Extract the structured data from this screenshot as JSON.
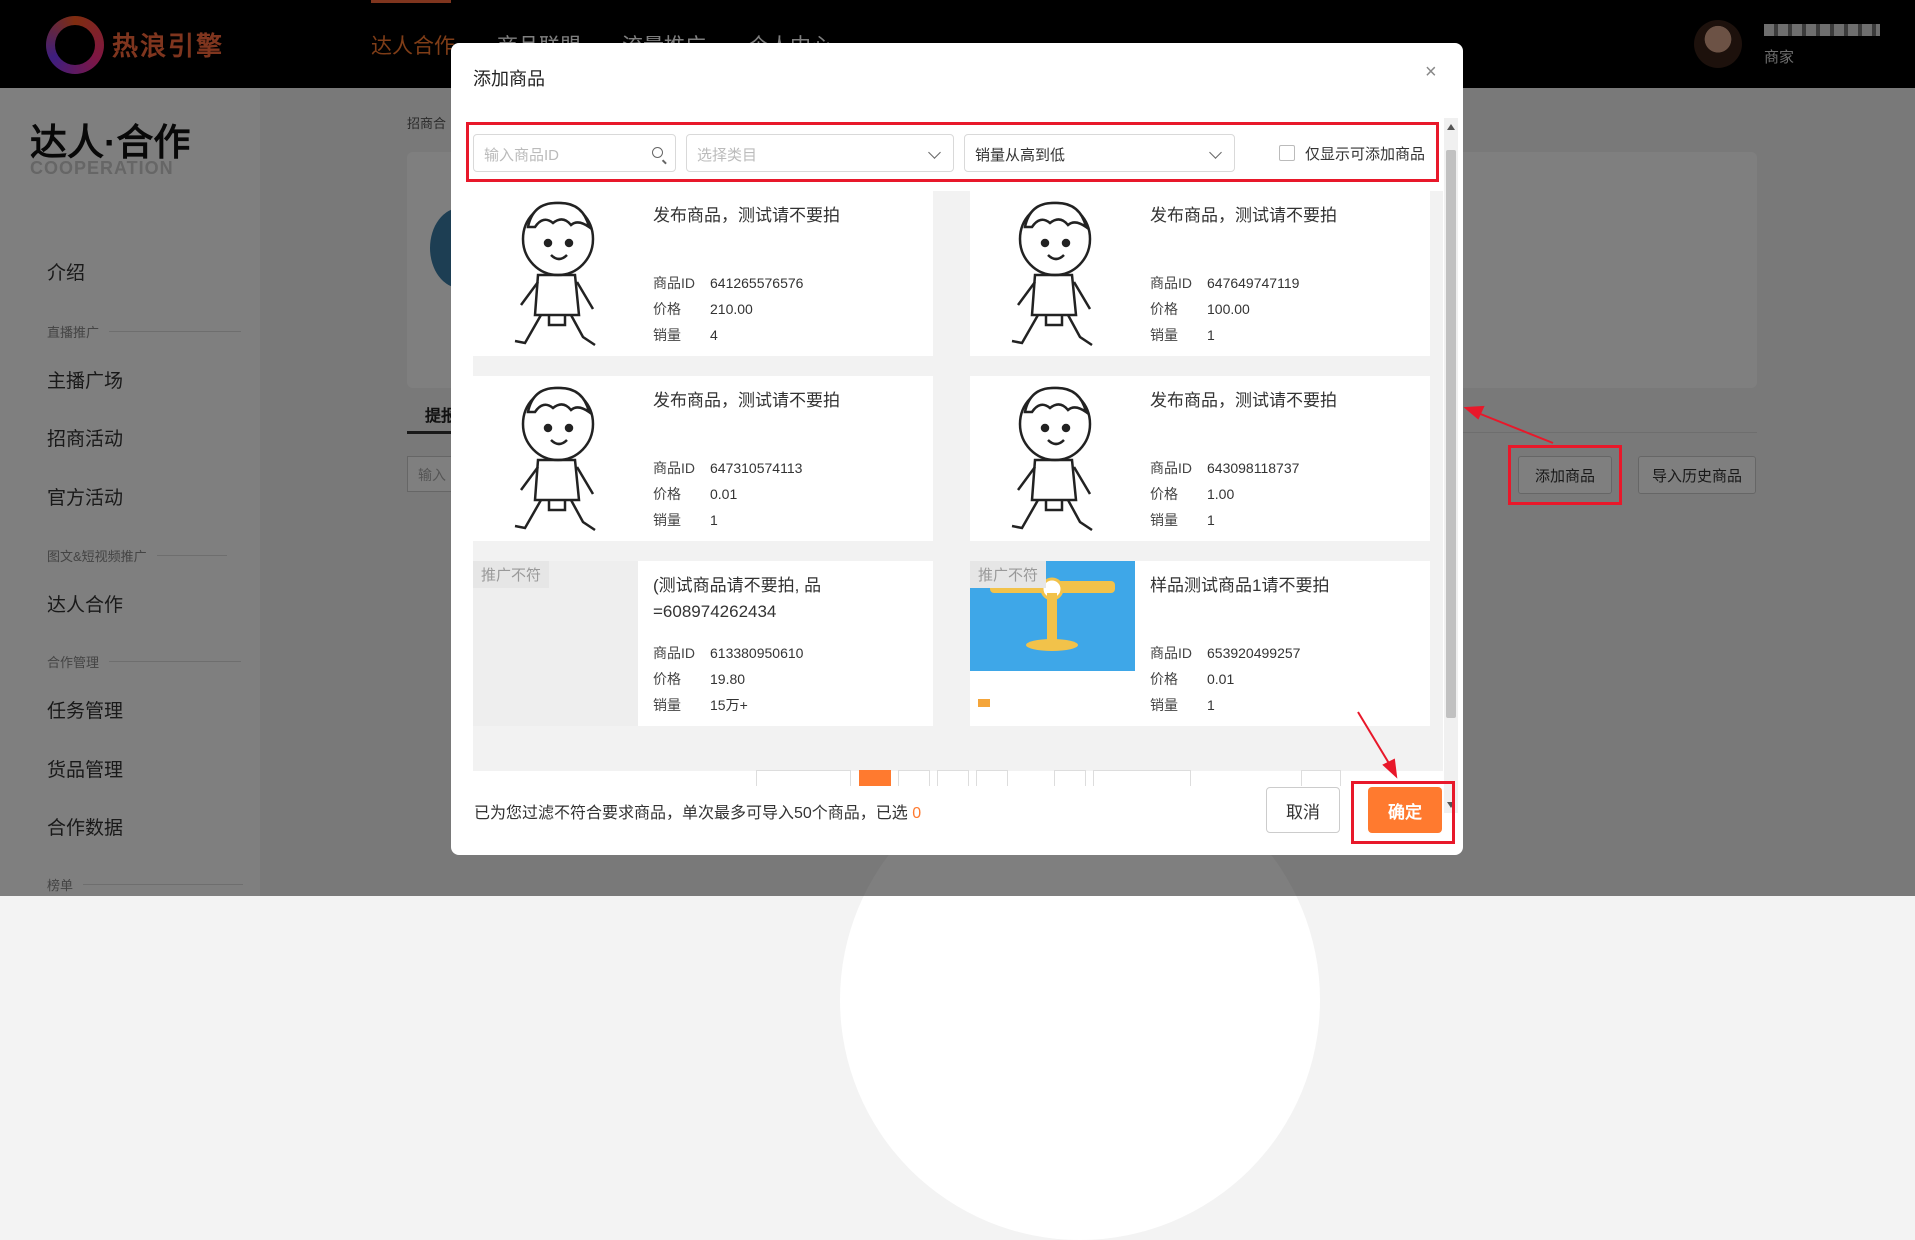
{
  "header": {
    "logo_text": "热浪引擎",
    "nav": [
      "达人合作",
      "商品联盟",
      "流量推广",
      "个人中心"
    ],
    "user_role": "商家"
  },
  "sidebar": {
    "title": "达人·合作",
    "subtitle": "COOPERATION",
    "items": [
      {
        "label": "介绍"
      },
      {
        "group": "直播推广"
      },
      {
        "label": "主播广场"
      },
      {
        "label": "招商活动"
      },
      {
        "label": "官方活动"
      },
      {
        "group": "图文&短视频推广"
      },
      {
        "label": "达人合作"
      },
      {
        "group": "合作管理"
      },
      {
        "label": "任务管理"
      },
      {
        "label": "货品管理"
      },
      {
        "label": "合作数据"
      },
      {
        "group": "榜单"
      }
    ]
  },
  "page": {
    "breadcrumb": "招商合",
    "tab": "提报",
    "search_placeholder": "输入",
    "add_product_button": "添加商品",
    "import_history_button": "导入历史商品"
  },
  "modal": {
    "title": "添加商品",
    "close": "×",
    "filters": {
      "id_placeholder": "输入商品ID",
      "category_placeholder": "选择类目",
      "sort_value": "销量从高到低",
      "only_addable_label": "仅显示可添加商品"
    },
    "field_labels": {
      "id": "商品ID",
      "price": "价格",
      "sales": "销量"
    },
    "products": [
      {
        "name": "发布商品，测试请不要拍",
        "id": "641265576576",
        "price": "210.00",
        "sales": "4",
        "tag": ""
      },
      {
        "name": "发布商品，测试请不要拍",
        "id": "647649747119",
        "price": "100.00",
        "sales": "1",
        "tag": ""
      },
      {
        "name": "发布商品，测试请不要拍",
        "id": "647310574113",
        "price": "0.01",
        "sales": "1",
        "tag": ""
      },
      {
        "name": "发布商品，测试请不要拍",
        "id": "643098118737",
        "price": "1.00",
        "sales": "1",
        "tag": ""
      },
      {
        "name": "(测试商品请不要拍,  品 =608974262434",
        "id": "613380950610",
        "price": "19.80",
        "sales": "15万+",
        "tag": "推广不符"
      },
      {
        "name": "样品测试商品1请不要拍",
        "id": "653920499257",
        "price": "0.01",
        "sales": "1",
        "tag": "推广不符"
      }
    ],
    "footer_text": "已为您过滤不符合要求商品，单次最多可导入50个商品，已选",
    "selected_count": "0",
    "cancel_button": "取消",
    "confirm_button": "确定"
  },
  "colors": {
    "accent": "#ff7a2f",
    "annotation": "#e8182a",
    "overlay": "rgba(0,0,0,0.5)"
  }
}
